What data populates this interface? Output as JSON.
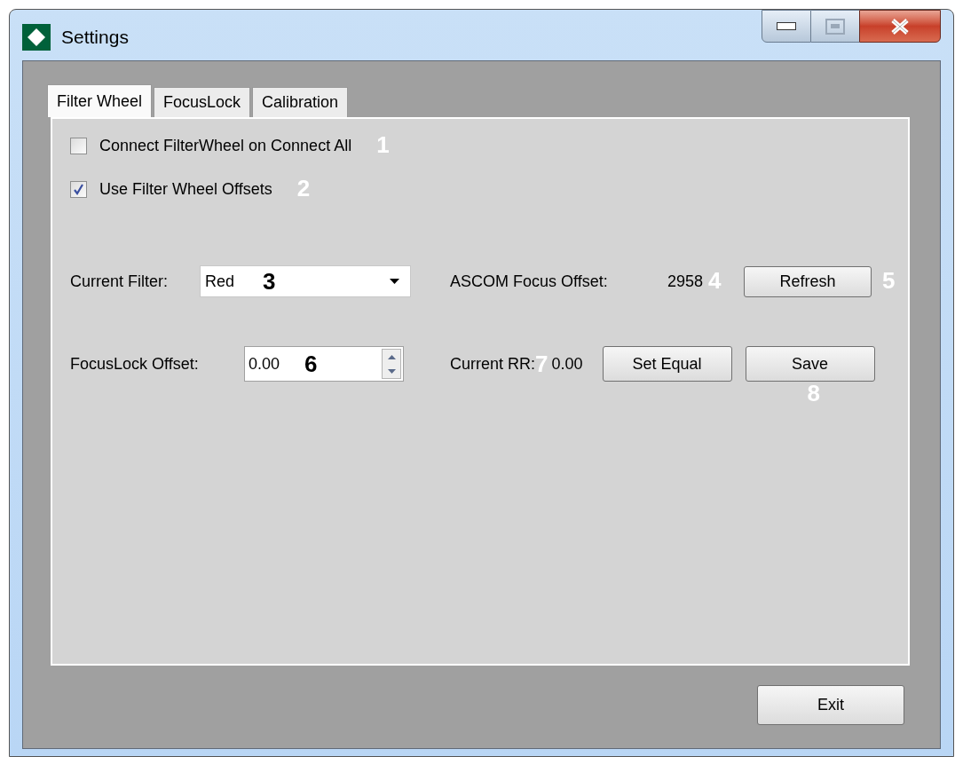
{
  "window": {
    "title": "Settings"
  },
  "tabs": [
    {
      "label": "Filter Wheel",
      "selected": true
    },
    {
      "label": "FocusLock",
      "selected": false
    },
    {
      "label": "Calibration",
      "selected": false
    }
  ],
  "checkboxes": [
    {
      "label": "Connect FilterWheel on Connect All",
      "checked": false,
      "callout": "1"
    },
    {
      "label": "Use Filter Wheel Offsets",
      "checked": true,
      "callout": "2"
    }
  ],
  "current_filter": {
    "label": "Current Filter:",
    "value": "Red",
    "callout": "3"
  },
  "ascom_focus_offset": {
    "label": "ASCOM Focus Offset:",
    "value": "2958",
    "callout": "4"
  },
  "refresh_button": {
    "label": "Refresh",
    "callout": "5"
  },
  "focuslock_offset": {
    "label": "FocusLock Offset:",
    "value": "0.00",
    "callout": "6"
  },
  "current_rr": {
    "label": "Current RR:",
    "callout": "7",
    "value": "0.00"
  },
  "set_equal_button": {
    "label": "Set Equal"
  },
  "save_button": {
    "label": "Save",
    "callout": "8"
  },
  "exit_button": {
    "label": "Exit"
  }
}
